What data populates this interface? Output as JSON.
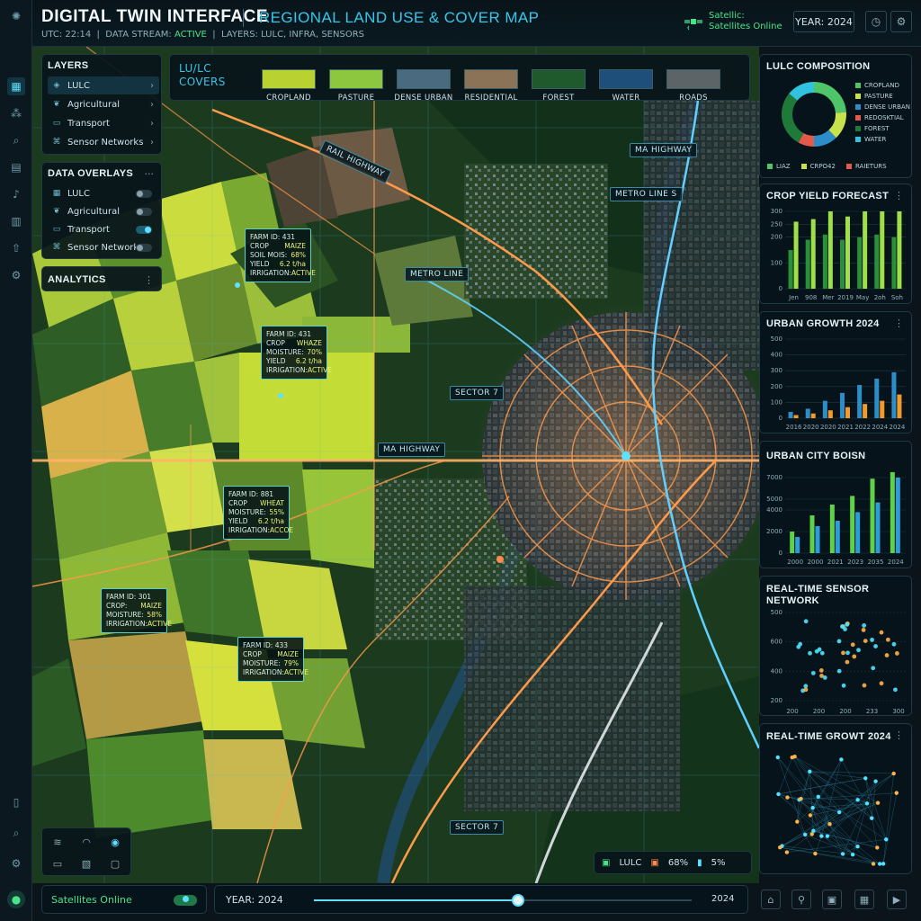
{
  "header": {
    "title": "DIGITAL TWIN INTERFACE",
    "subtitle": "REGIONAL LAND USE & COVER MAP",
    "utc": "UTC: 22:14",
    "stream_label": "DATA STREAM:",
    "stream_value": "ACTIVE",
    "layers_meta": "LAYERS: LULC, INFRA, SENSORS",
    "satellite_line1": "Satellic:",
    "satellite_line2": "Satellites Online",
    "year": "YEAR: 2024"
  },
  "layers_panel": {
    "title": "LAYERS",
    "items": [
      {
        "label": "LULC",
        "icon": "layers-icon"
      },
      {
        "label": "Agricultural",
        "icon": "leaf-icon"
      },
      {
        "label": "Transport",
        "icon": "car-icon"
      },
      {
        "label": "Sensor Networks",
        "icon": "sensor-icon"
      }
    ]
  },
  "overlays_panel": {
    "title": "DATA OVERLAYS",
    "items": [
      {
        "label": "LULC",
        "on": false
      },
      {
        "label": "Agricultural",
        "on": false
      },
      {
        "label": "Transport",
        "on": true
      },
      {
        "label": "Sensor Networks",
        "on": false
      }
    ]
  },
  "analytics_panel": {
    "title": "ANALYTICS"
  },
  "legend": {
    "title_line1": "LU/LC",
    "title_line2": "COVERS",
    "items": [
      {
        "label": "CROPLAND",
        "color": "#b9d232"
      },
      {
        "label": "PASTURE",
        "color": "#8dc63f"
      },
      {
        "label": "DENSE URBAN",
        "color": "#4a6a80"
      },
      {
        "label": "RESIDENTIAL",
        "color": "#8a7356"
      },
      {
        "label": "FOREST",
        "color": "#1f5a2c"
      },
      {
        "label": "WATER",
        "color": "#1d4f7a"
      },
      {
        "label": "ROADS",
        "color": "#5c6468"
      }
    ]
  },
  "map_labels": {
    "highway_top": "MA HIGHWAY",
    "rail_highway": "RAIL HIGHWAY",
    "metro_line_s": "METRO LINE S",
    "metro_line": "METRO LINE",
    "sector7_a": "SECTOR 7",
    "ma_highway_mid": "MA HIGHWAY",
    "sector7_b": "SECTOR 7"
  },
  "farms": [
    {
      "id": "FARM ID: 431",
      "r1k": "CROP",
      "r1v": "MAIZE",
      "r2k": "SOIL MOIS:",
      "r2v": "68%",
      "r3k": "YIELD",
      "r3v": "6.2 t/ha",
      "r4k": "IRRIGATION:",
      "r4v": "ACTIVE"
    },
    {
      "id": "FARM ID: 431",
      "r1k": "CROP",
      "r1v": "WHAZE",
      "r2k": "MOISTURE:",
      "r2v": "70%",
      "r3k": "YIELD",
      "r3v": "6.2 t/ha",
      "r4k": "IRRIGATION:",
      "r4v": "ACTIVE"
    },
    {
      "id": "FARM ID: 881",
      "r1k": "CROP",
      "r1v": "WHEAT",
      "r2k": "MOISTURE:",
      "r2v": "55%",
      "r3k": "YIELD",
      "r3v": "6.2 t/ha",
      "r4k": "IRRIGATION:",
      "r4v": "ACCOE"
    },
    {
      "id": "FARM ID: 301",
      "r1k": "CROP:",
      "r1v": "MAIZE",
      "r2k": "MOISTURE:",
      "r2v": "58%",
      "r3k": "IRRIGATION:",
      "r3v": "ACTIVE"
    },
    {
      "id": "FARM ID: 433",
      "r1k": "CROP",
      "r1v": "MAIZE",
      "r2k": "MOISTURE:",
      "r2v": "79%",
      "r3k": "IRRIGATION:",
      "r3v": "ACTIVE"
    }
  ],
  "map_status": {
    "lulc": "LULC",
    "pct1": "68%",
    "pct2": "5%"
  },
  "bottom": {
    "satellites": "Satellites Online",
    "year_label": "YEAR: 2024",
    "year_end": "2024",
    "slider_value": 0.54
  },
  "widgets": {
    "composition": {
      "title": "LULC COMPOSITION",
      "legend": [
        "CROPLAND",
        "PASTURE",
        "DENSE URBAN",
        "REDOSKTIAL",
        "FOREST",
        "WATER"
      ],
      "footer": [
        "LIAZ",
        "CRPO42",
        "RAIETURS"
      ],
      "colors": [
        "#4fc56a",
        "#c7e24a",
        "#2b8ec9",
        "#e45a4a",
        "#1f7a3a",
        "#31c2e0"
      ]
    },
    "crop_yield": {
      "title": "CROP YIELD FORECAST"
    },
    "urban_growth": {
      "title": "URBAN GROWTH 2024"
    },
    "urban_city": {
      "title": "URBAN CITY BOISN"
    },
    "sensor_network": {
      "title_line1": "REAL-TIME SENSOR",
      "title_line2": "NETWORK"
    },
    "realtime_growth": {
      "title": "REAL-TIME GROWT 2024"
    }
  },
  "chart_data": [
    {
      "type": "pie",
      "title": "LULC COMPOSITION",
      "categories": [
        "CROPLAND",
        "PASTURE",
        "DENSE URBAN",
        "REDOSKTIAL",
        "FOREST",
        "WATER"
      ],
      "values": [
        24,
        14,
        12,
        8,
        28,
        14
      ]
    },
    {
      "type": "bar",
      "title": "CROP YIELD FORECAST",
      "categories": [
        "Jen",
        "908",
        "Mer",
        "2019",
        "May",
        "2oh",
        "Soh"
      ],
      "series": [
        {
          "values": [
            150,
            190,
            210,
            190,
            200,
            210,
            200
          ]
        },
        {
          "values": [
            260,
            270,
            310,
            280,
            300,
            320,
            330
          ]
        }
      ],
      "ylim": [
        0,
        300
      ],
      "yticks": [
        0,
        100,
        200,
        250,
        300
      ]
    },
    {
      "type": "bar",
      "title": "URBAN GROWTH 2024",
      "categories": [
        "2016",
        "2020",
        "2020",
        "2021",
        "2022",
        "2024",
        "2024"
      ],
      "series": [
        {
          "values": [
            40,
            60,
            110,
            160,
            210,
            250,
            290
          ]
        },
        {
          "values": [
            20,
            30,
            50,
            70,
            90,
            110,
            150
          ]
        }
      ],
      "ylim": [
        0,
        500
      ],
      "yticks": [
        0,
        100,
        200,
        300,
        400,
        500
      ]
    },
    {
      "type": "bar",
      "title": "URBAN CITY BOISN",
      "categories": [
        "2000",
        "2000",
        "2021",
        "2023",
        "2035",
        "2024"
      ],
      "series": [
        {
          "values": [
            2000,
            3500,
            4500,
            5300,
            6900,
            9100
          ]
        },
        {
          "values": [
            1500,
            2500,
            3000,
            3800,
            4700,
            7000
          ]
        }
      ],
      "ylim": [
        0,
        7500
      ],
      "yticks": [
        0,
        2000,
        4000,
        5000,
        7000
      ]
    },
    {
      "type": "scatter",
      "title": "REAL-TIME SENSOR NETWORK",
      "x_ticks": [
        "200",
        "200",
        "200",
        "233",
        "300"
      ],
      "y_ticks": [
        "200",
        "400",
        "600",
        "500"
      ]
    }
  ]
}
